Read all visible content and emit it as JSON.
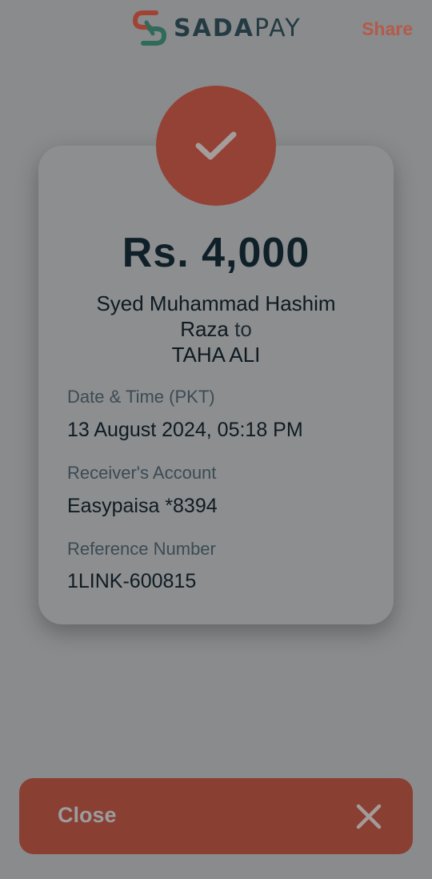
{
  "header": {
    "brand_bold": "SADA",
    "brand_light": "PAY",
    "share_label": "Share"
  },
  "receipt": {
    "amount": "Rs. 4,000",
    "sender_line1": "Syed Muhammad Hashim",
    "sender_line2": "Raza",
    "to_word": "to",
    "receiver": "TAHA ALI",
    "fields": [
      {
        "label": "Date & Time (PKT)",
        "value": "13 August 2024, 05:18 PM"
      },
      {
        "label": "Receiver's Account",
        "value": "Easypaisa *8394"
      },
      {
        "label": "Reference Number",
        "value": "1LINK-600815"
      }
    ]
  },
  "footer": {
    "close_label": "Close"
  },
  "icons": {
    "logo": "sadapay-logo-icon",
    "check": "checkmark-icon",
    "close": "close-icon"
  },
  "colors": {
    "accent": "#944236",
    "background": "#898b8d",
    "brand_text": "#243b43"
  }
}
